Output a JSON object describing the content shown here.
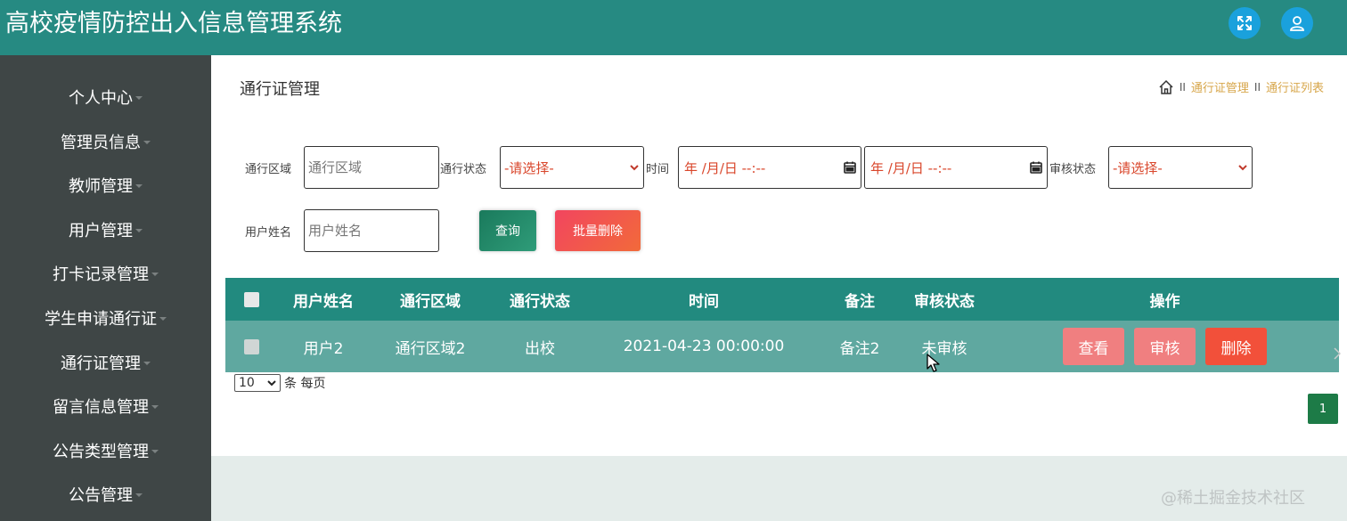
{
  "header": {
    "title": "高校疫情防控出入信息管理系统",
    "fullscreen_icon": "fullscreen-icon",
    "user_icon": "user-icon",
    "accent_color": "#268a82"
  },
  "sidebar": {
    "items": [
      {
        "label": "个人中心"
      },
      {
        "label": "管理员信息"
      },
      {
        "label": "教师管理"
      },
      {
        "label": "用户管理"
      },
      {
        "label": "打卡记录管理"
      },
      {
        "label": "学生申请通行证"
      },
      {
        "label": "通行证管理"
      },
      {
        "label": "留言信息管理"
      },
      {
        "label": "公告类型管理"
      },
      {
        "label": "公告管理"
      }
    ]
  },
  "main": {
    "page_title": "通行证管理",
    "breadcrumb": {
      "home_icon": "home-icon",
      "separator": "II",
      "items": [
        "通行证管理",
        "通行证列表"
      ]
    },
    "filters": {
      "area_label": "通行区域",
      "area_placeholder": "通行区域",
      "status_label": "通行状态",
      "status_value": "-请选择-",
      "time_label": "时间",
      "time_start": "年 /月/日 --:--",
      "time_end": "年 /月/日 --:--",
      "review_label": "审核状态",
      "review_value": "-请选择-",
      "name_label": "用户姓名",
      "name_placeholder": "用户姓名"
    },
    "buttons": {
      "search": "查询",
      "batch_delete": "批量删除"
    },
    "table": {
      "columns": [
        "用户姓名",
        "通行区域",
        "通行状态",
        "时间",
        "备注",
        "审核状态",
        "操作"
      ],
      "rows": [
        {
          "name": "用户2",
          "area": "通行区域2",
          "status": "出校",
          "time": "2021-04-23 00:00:00",
          "remark": "备注2",
          "review": "未审核",
          "actions": [
            "查看",
            "审核",
            "删除"
          ]
        }
      ]
    },
    "pagination": {
      "page_size": "10",
      "page_size_suffix": "条 每页",
      "current_page": "1"
    }
  },
  "watermark": "@稀土掘金技术社区"
}
